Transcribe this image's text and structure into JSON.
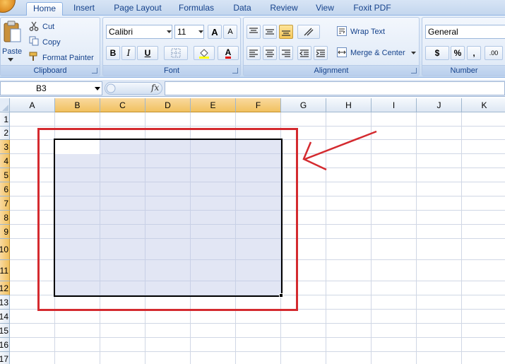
{
  "tabs": [
    "Home",
    "Insert",
    "Page Layout",
    "Formulas",
    "Data",
    "Review",
    "View",
    "Foxit PDF"
  ],
  "clipboard": {
    "paste_label": "Paste",
    "cut_label": "Cut",
    "copy_label": "Copy",
    "format_painter_label": "Format Painter",
    "group_label": "Clipboard"
  },
  "font": {
    "name": "Calibri",
    "size": "11",
    "bold": "B",
    "italic": "I",
    "underline": "U",
    "grow_glyph": "A",
    "shrink_glyph": "A",
    "color_glyph": "A",
    "group_label": "Font"
  },
  "alignment": {
    "wrap_text_label": "Wrap Text",
    "merge_center_label": "Merge & Center",
    "group_label": "Alignment"
  },
  "number": {
    "format": "General",
    "currency_glyph": "$",
    "percent_glyph": "%",
    "comma_glyph": ",",
    "decimal_glyph": ".00",
    "group_label": "Number"
  },
  "formula_bar": {
    "name_box": "B3",
    "fx_label": "fx",
    "value": ""
  },
  "sheet": {
    "columns": [
      "A",
      "B",
      "C",
      "D",
      "E",
      "F",
      "G",
      "H",
      "I",
      "J",
      "K"
    ],
    "rows": [
      "1",
      "2",
      "3",
      "4",
      "5",
      "6",
      "7",
      "8",
      "9",
      "10",
      "11",
      "12",
      "13",
      "14",
      "15",
      "16",
      "17"
    ],
    "selected_range": "B3:F12",
    "active_cell": "B3"
  },
  "colors": {
    "annotation_red": "#d42a2f",
    "selected_header": "#f1c15f",
    "ribbon_text": "#15428b"
  }
}
